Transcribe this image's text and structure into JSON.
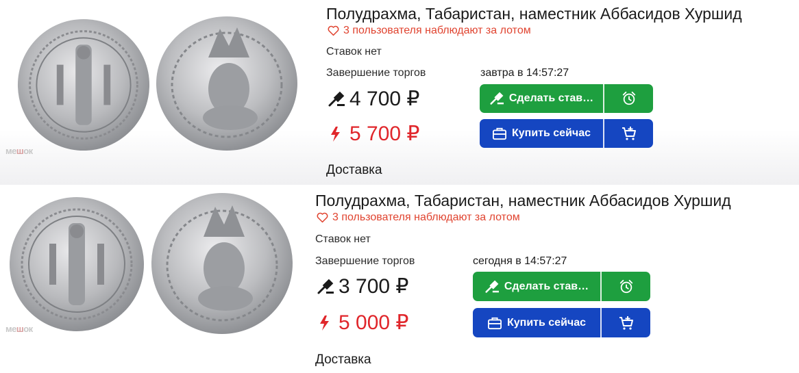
{
  "watermark": {
    "pre": "ме",
    "mid": "ш",
    "post": "ок"
  },
  "colors": {
    "green": "#1e9f3f",
    "blue": "#1546c1",
    "red": "#e0262b",
    "watch": "#e0432f"
  },
  "lots": [
    {
      "title": "Полудрахма, Табаристан, наместник Аббасидов Хуршид",
      "watchers": "3 пользователя наблюдают за лотом",
      "bids": "Ставок нет",
      "end_label": "Завершение торгов",
      "end_time": "завтра в 14:57:27",
      "current_price": "4 700 ₽",
      "buy_now_price": "5 700 ₽",
      "bid_button": "Сделать став…",
      "buy_button": "Купить сейчас",
      "delivery": "Доставка"
    },
    {
      "title": "Полудрахма, Табаристан, наместник Аббасидов Хуршид",
      "watchers": "3 пользователя наблюдают за лотом",
      "bids": "Ставок нет",
      "end_label": "Завершение торгов",
      "end_time": "сегодня в 14:57:27",
      "current_price": "3 700 ₽",
      "buy_now_price": "5 000 ₽",
      "bid_button": "Сделать став…",
      "buy_button": "Купить сейчас",
      "delivery": "Доставка"
    }
  ]
}
